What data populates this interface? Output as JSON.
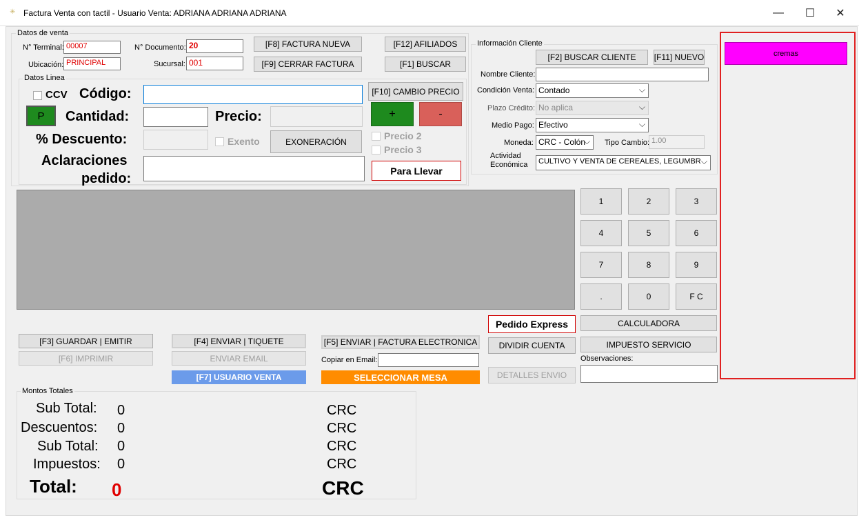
{
  "window": {
    "title": "Factura Venta con tactil - Usuario Venta: ADRIANA ADRIANA ADRIANA",
    "minimize": "—",
    "maximize": "☐",
    "close": "✕"
  },
  "datos_venta": {
    "group_label": "Datos de venta",
    "terminal_label": "N° Terminal:",
    "terminal_value": "00007",
    "documento_label": "N° Documento:",
    "documento_value": "20",
    "ubicacion_label": "Ubicación:",
    "ubicacion_value": "PRINCIPAL",
    "sucursal_label": "Sucursal:",
    "sucursal_value": "001",
    "factura_nueva": "[F8] FACTURA NUEVA",
    "cerrar_factura": "[F9] CERRAR FACTURA",
    "afiliados": "[F12] AFILIADOS",
    "buscar": "[F1] BUSCAR"
  },
  "datos_linea": {
    "group_label": "Datos Linea",
    "ccv_label": "CCV",
    "codigo_label": "Código:",
    "codigo_value": "",
    "cambio_precio": "[F10] CAMBIO PRECIO",
    "p_button": "P",
    "cantidad_label": "Cantidad:",
    "cantidad_value": "",
    "precio_label": "Precio:",
    "precio_value": "",
    "plus_button": "+",
    "minus_button": "-",
    "descuento_label": "% Descuento:",
    "descuento_value": "",
    "exento_label": "Exento",
    "exoneracion": "EXONERACIÓN",
    "precio2_label": "Precio 2",
    "precio3_label": "Precio 3",
    "aclaraciones_label_1": "Aclaraciones",
    "aclaraciones_label_2": "pedido:",
    "aclaraciones_value": "",
    "para_llevar": "Para Llevar"
  },
  "cliente": {
    "group_label": "Información Cliente",
    "buscar_cliente": "[F2] BUSCAR CLIENTE",
    "nuevo": "[F11] NUEVO",
    "nombre_label": "Nombre Cliente:",
    "nombre_value": "",
    "condicion_label": "Condición Venta:",
    "condicion_value": "Contado",
    "plazo_label": "Plazo Crédito:",
    "plazo_value": "No aplica",
    "medio_label": "Medio Pago:",
    "medio_value": "Efectivo",
    "moneda_label": "Moneda:",
    "moneda_value": "CRC - Colón",
    "tipo_cambio_label": "Tipo Cambio:",
    "tipo_cambio_value": "1.00",
    "actividad_label_1": "Actividad",
    "actividad_label_2": "Económica",
    "actividad_value": "CULTIVO Y VENTA DE CEREALES, LEGUMBR"
  },
  "numpad": {
    "keys": [
      "1",
      "2",
      "3",
      "4",
      "5",
      "6",
      "7",
      "8",
      "9",
      ".",
      "0",
      "F C"
    ],
    "calculadora": "CALCULADORA",
    "impuesto_servicio": "IMPUESTO SERVICIO",
    "observaciones_label": "Observaciones:",
    "observaciones_value": ""
  },
  "actions": {
    "guardar": "[F3] GUARDAR | EMITIR",
    "imprimir": "[F6] IMPRIMIR",
    "enviar_tiquete": "[F4] ENVIAR | TIQUETE",
    "enviar_email": "ENVIAR EMAIL",
    "usuario_venta": "[F7] USUARIO VENTA",
    "enviar_factura": "[F5] ENVIAR | FACTURA ELECTRONICA",
    "copiar_email_label": "Copiar en Email:",
    "copiar_email_value": "",
    "seleccionar_mesa": "SELECCIONAR MESA",
    "pedido_express": "Pedido Express",
    "dividir_cuenta": "DIVIDIR CUENTA",
    "detalles_envio": "DETALLES ENVIO"
  },
  "totales": {
    "group_label": "Montos Totales",
    "subtotal_label": "Sub Total:",
    "subtotal_value": "0",
    "descuentos_label": "Descuentos:",
    "descuentos_value": "0",
    "subtotal2_label": "Sub Total:",
    "subtotal2_value": "0",
    "impuestos_label": "Impuestos:",
    "impuestos_value": "0",
    "total_label": "Total:",
    "total_value": "0",
    "currency": "CRC"
  },
  "categories": {
    "items": [
      "cremas"
    ]
  },
  "colors": {
    "category_button": "#ff00ff",
    "highlight_border": "#e02020",
    "usuario_venta": "#6b9bea",
    "seleccionar_mesa": "#ff8c00",
    "plus_button": "#1e8a1e",
    "minus_button": "#d9605a",
    "total_value": "#e00000"
  }
}
